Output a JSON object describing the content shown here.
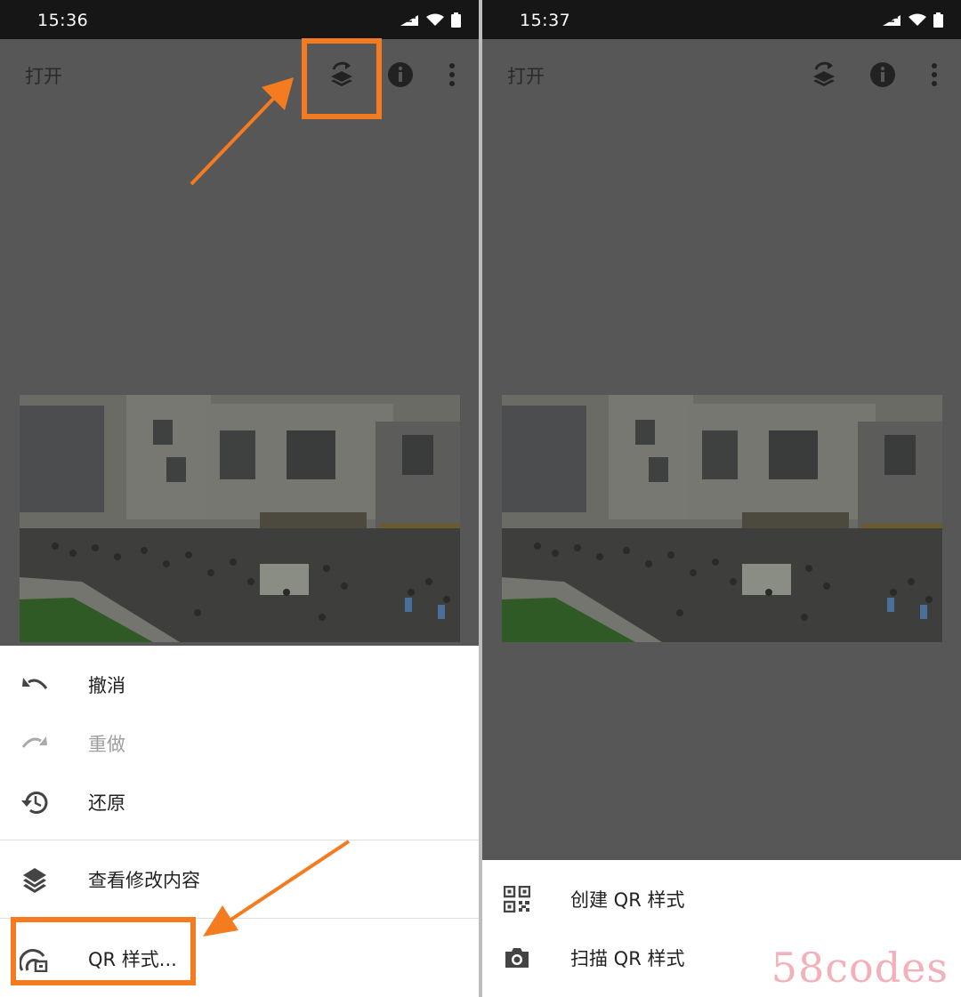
{
  "left": {
    "status_time": "15:36",
    "toolbar": {
      "open_label": "打开"
    },
    "menu": {
      "undo": "撤消",
      "redo": "重做",
      "revert": "还原",
      "view_edits": "查看修改内容",
      "qr_style": "QR 样式..."
    }
  },
  "right": {
    "status_time": "15:37",
    "toolbar": {
      "open_label": "打开"
    },
    "menu": {
      "create_qr": "创建 QR 样式",
      "scan_qr": "扫描 QR 样式"
    }
  },
  "watermark": "58codes",
  "colors": {
    "highlight": "#f47b20",
    "statusbar": "#161616",
    "scrim": "#575757",
    "sheet": "#ffffff"
  },
  "icons": [
    "stack-history-icon",
    "info-icon",
    "more-vert-icon",
    "undo-icon",
    "redo-icon",
    "restore-icon",
    "layers-icon",
    "qr-style-icon",
    "qr-code-icon",
    "camera-icon"
  ]
}
